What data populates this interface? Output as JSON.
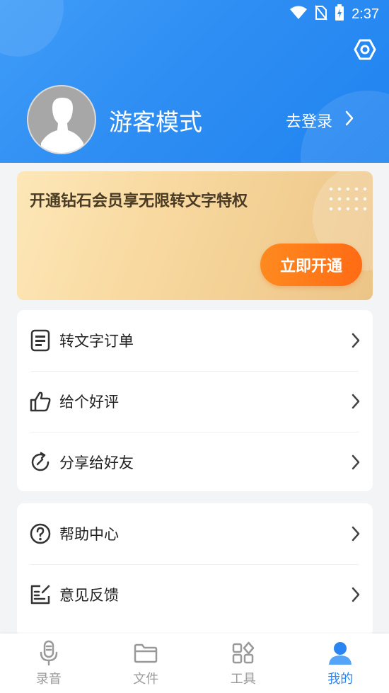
{
  "status": {
    "time": "2:37"
  },
  "profile": {
    "mode_label": "游客模式",
    "login_label": "去登录"
  },
  "vip": {
    "title": "开通钻石会员享无限转文字特权",
    "button": "立即开通"
  },
  "menu_card_1": [
    {
      "label": "转文字订单",
      "icon": "document-list-icon"
    },
    {
      "label": "给个好评",
      "icon": "thumbs-up-icon"
    },
    {
      "label": "分享给好友",
      "icon": "share-refresh-icon"
    }
  ],
  "menu_card_2": [
    {
      "label": "帮助中心",
      "icon": "help-circle-icon"
    },
    {
      "label": "意见反馈",
      "icon": "feedback-edit-icon"
    }
  ],
  "bottom_nav": [
    {
      "label": "录音",
      "icon": "microphone-icon",
      "active": false
    },
    {
      "label": "文件",
      "icon": "folder-icon",
      "active": false
    },
    {
      "label": "工具",
      "icon": "tools-grid-icon",
      "active": false
    },
    {
      "label": "我的",
      "icon": "user-icon",
      "active": true
    }
  ],
  "colors": {
    "primary": "#2a85f2",
    "vip_button": "#ff6b14",
    "vip_text": "#4a3b25"
  }
}
